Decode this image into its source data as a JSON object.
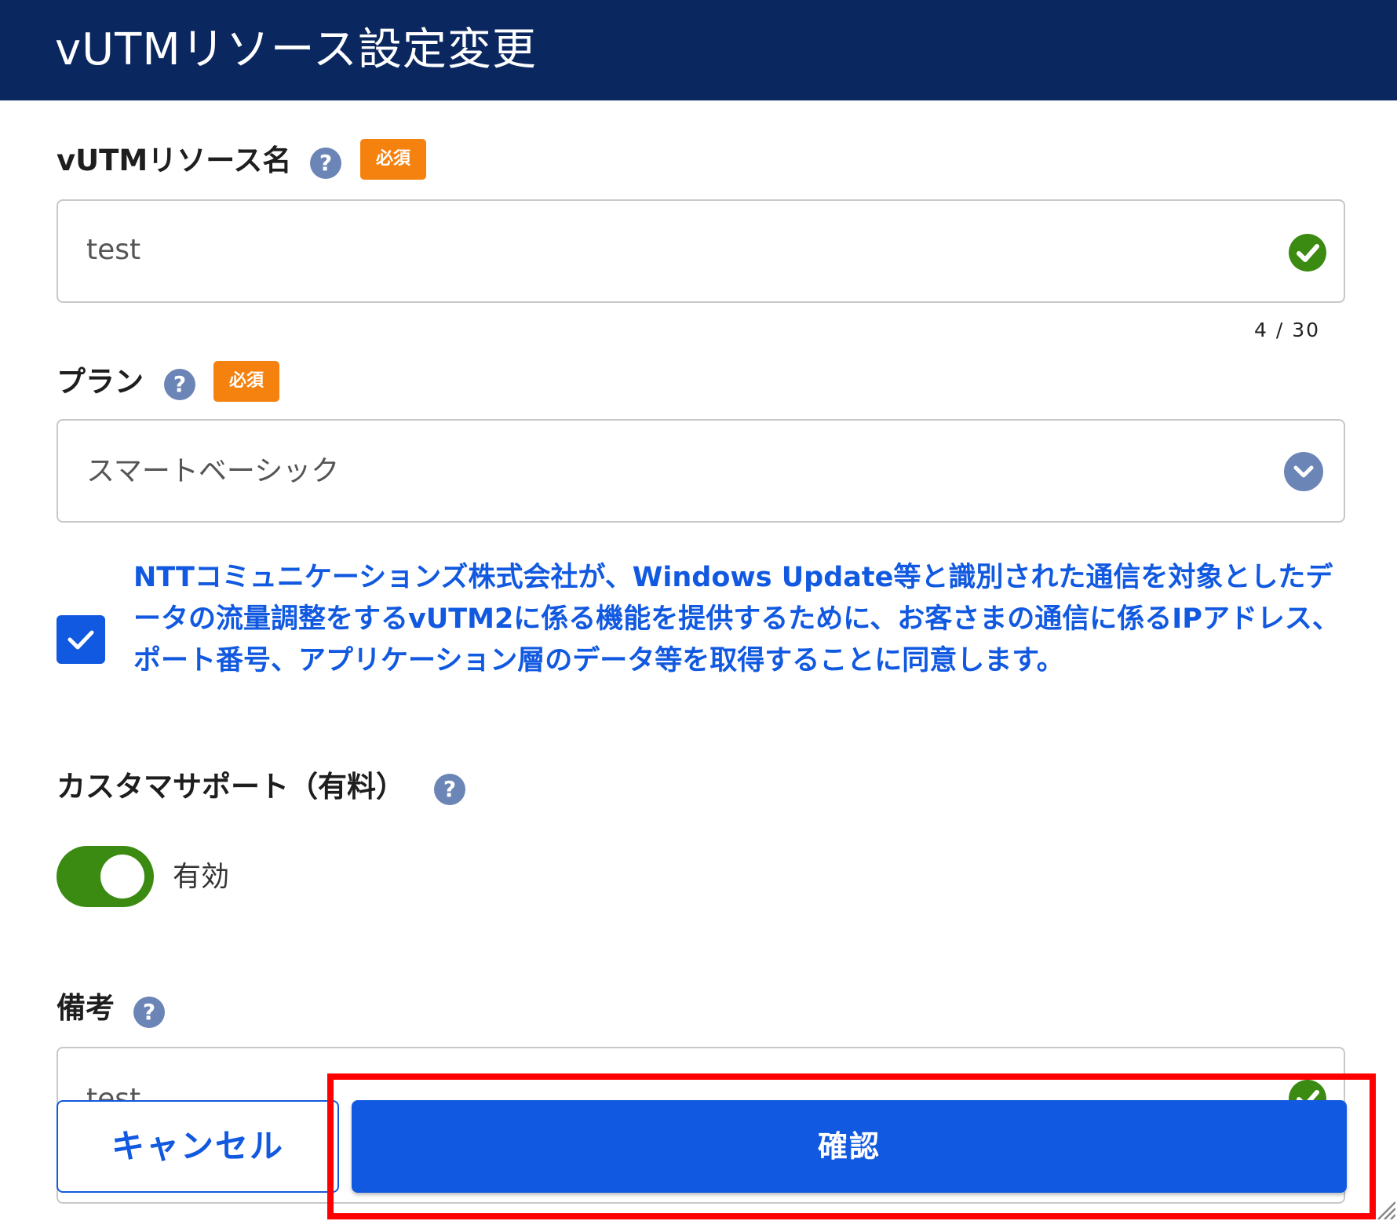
{
  "dialog": {
    "title": "vUTMリソース設定変更"
  },
  "resource_name": {
    "label": "vUTMリソース名",
    "help_icon": "?",
    "required_badge": "必須",
    "value": "test",
    "counter": "4 / 30",
    "status_icon": "check-circle-icon"
  },
  "plan": {
    "label": "プラン",
    "help_icon": "?",
    "required_badge": "必須",
    "selected": "スマートベーシック",
    "dropdown_icon": "chevron-down-icon"
  },
  "consent": {
    "checked": true,
    "text": "NTTコミュニケーションズ株式会社が、Windows Update等と識別された通信を対象としたデータの流量調整をするvUTM2に係る機能を提供するために、お客さまの通信に係るIPアドレス、ポート番号、アプリケーション層のデータ等を取得することに同意します。"
  },
  "customer_support": {
    "label": "カスタマサポート（有料）",
    "help_icon": "?",
    "toggle_on": true,
    "toggle_label": "有効"
  },
  "remarks": {
    "label": "備考",
    "help_icon": "?",
    "value": "test"
  },
  "footer": {
    "cancel_label": "キャンセル",
    "confirm_label": "確認"
  },
  "colors": {
    "header_bg": "#0b2760",
    "primary": "#1159e0",
    "required": "#f5820f",
    "success": "#3b8a12",
    "help": "#6b85b6",
    "highlight": "#ff0000"
  }
}
